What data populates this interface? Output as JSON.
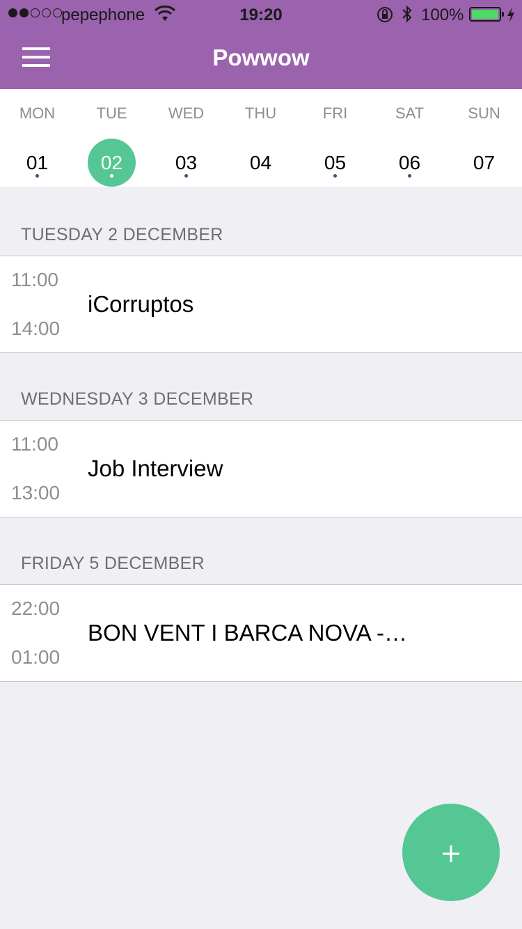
{
  "status_bar": {
    "carrier": "pepephone",
    "time": "19:20",
    "battery_percent": "100%",
    "battery_level": 1.0,
    "signal_bars_filled": 2,
    "signal_bars_total": 5
  },
  "nav": {
    "title": "Powwow",
    "menu_icon": "hamburger-menu-icon"
  },
  "week": {
    "days": [
      {
        "name": "MON",
        "number": "01",
        "has_events": true,
        "selected": false
      },
      {
        "name": "TUE",
        "number": "02",
        "has_events": true,
        "selected": true
      },
      {
        "name": "WED",
        "number": "03",
        "has_events": true,
        "selected": false
      },
      {
        "name": "THU",
        "number": "04",
        "has_events": false,
        "selected": false
      },
      {
        "name": "FRI",
        "number": "05",
        "has_events": true,
        "selected": false
      },
      {
        "name": "SAT",
        "number": "06",
        "has_events": true,
        "selected": false
      },
      {
        "name": "SUN",
        "number": "07",
        "has_events": false,
        "selected": false
      }
    ]
  },
  "sections": [
    {
      "header": "TUESDAY 2 DECEMBER",
      "events": [
        {
          "start": "11:00",
          "end": "14:00",
          "title": "iCorruptos"
        }
      ]
    },
    {
      "header": "WEDNESDAY 3 DECEMBER",
      "events": [
        {
          "start": "11:00",
          "end": "13:00",
          "title": "Job Interview"
        }
      ]
    },
    {
      "header": "FRIDAY 5 DECEMBER",
      "events": [
        {
          "start": "22:00",
          "end": "01:00",
          "title": "BON VENT I BARCA NOVA -…"
        }
      ]
    }
  ],
  "fab": {
    "icon": "plus-icon"
  },
  "colors": {
    "brand": "#9b62ad",
    "accent": "#54c794",
    "background": "#efeff4",
    "event_dot": "#2e5a7a"
  }
}
